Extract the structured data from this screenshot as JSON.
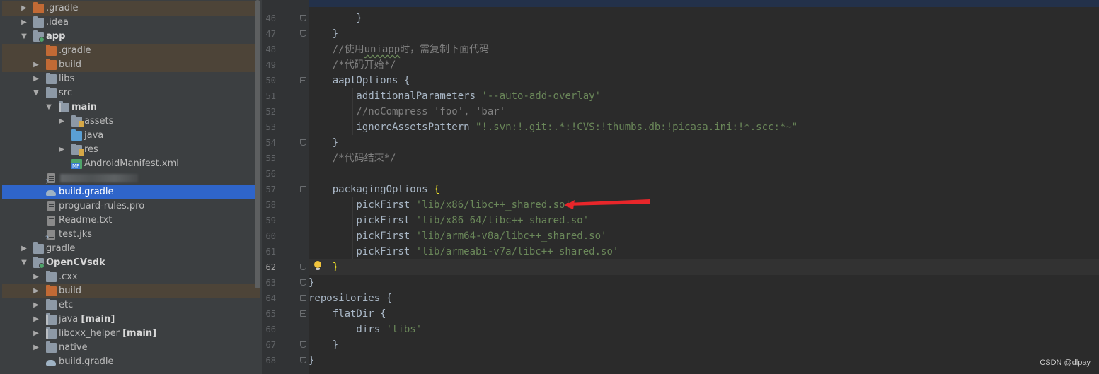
{
  "tree": {
    "items": [
      {
        "label": ".gradle",
        "bold": false
      },
      {
        "label": ".idea",
        "bold": false
      },
      {
        "label": "app",
        "bold": true
      },
      {
        "label": ".gradle",
        "bold": false
      },
      {
        "label": "build",
        "bold": false
      },
      {
        "label": "libs",
        "bold": false
      },
      {
        "label": "src",
        "bold": false
      },
      {
        "label": "main",
        "bold": true
      },
      {
        "label": "assets",
        "bold": false
      },
      {
        "label": "java",
        "bold": false
      },
      {
        "label": "res",
        "bold": false
      },
      {
        "label": "AndroidManifest.xml",
        "bold": false
      },
      {
        "label": "",
        "bold": false
      },
      {
        "label": "build.gradle",
        "bold": false
      },
      {
        "label": "proguard-rules.pro",
        "bold": false
      },
      {
        "label": "Readme.txt",
        "bold": false
      },
      {
        "label": "test.jks",
        "bold": false
      },
      {
        "label": "gradle",
        "bold": false
      },
      {
        "label": "OpenCVsdk",
        "bold": true
      },
      {
        "label": ".cxx",
        "bold": false
      },
      {
        "label": "build",
        "bold": false
      },
      {
        "label": "etc",
        "bold": false
      },
      {
        "label": "java",
        "bold": false,
        "suffix": "[main]"
      },
      {
        "label": "libcxx_helper",
        "bold": false,
        "suffix": "[main]"
      },
      {
        "label": "native",
        "bold": false
      },
      {
        "label": "build.gradle",
        "bold": false
      }
    ],
    "icons": {
      "folder": "folder-icon",
      "excluded_folder": "excluded-folder-icon",
      "module": "module-folder-icon",
      "gradle": "gradle-elephant-icon",
      "file": "text-file-icon",
      "manifest": "manifest-icon"
    }
  },
  "editor": {
    "lines": [
      {
        "n": "46",
        "text": "        }"
      },
      {
        "n": "47",
        "text": "    }"
      },
      {
        "n": "48",
        "text": "    //使用uniapp时，需复制下面代码"
      },
      {
        "n": "49",
        "text": "    /*代码开始*/"
      },
      {
        "n": "50",
        "text": "    aaptOptions {"
      },
      {
        "n": "51",
        "text_pre": "        additionalParameters ",
        "text_str": "'--auto-add-overlay'"
      },
      {
        "n": "52",
        "text": "        //noCompress 'foo', 'bar'"
      },
      {
        "n": "53",
        "text_pre": "        ignoreAssetsPattern ",
        "text_str": "\"!.svn:!.git:.*:!CVS:!thumbs.db:!picasa.ini:!*.scc:*~\""
      },
      {
        "n": "54",
        "text": "    }"
      },
      {
        "n": "55",
        "text": "    /*代码结束*/"
      },
      {
        "n": "56",
        "text": ""
      },
      {
        "n": "57",
        "text_pre": "    packagingOptions ",
        "text_brace": "{"
      },
      {
        "n": "58",
        "text_pre": "        pickFirst ",
        "text_str": "'lib/x86/libc++_shared.so'"
      },
      {
        "n": "59",
        "text_pre": "        pickFirst ",
        "text_str": "'lib/x86_64/libc++_shared.so'"
      },
      {
        "n": "60",
        "text_pre": "        pickFirst ",
        "text_str": "'lib/arm64-v8a/libc++_shared.so'"
      },
      {
        "n": "61",
        "text_pre": "        pickFirst ",
        "text_str": "'lib/armeabi-v7a/libc++_shared.so'"
      },
      {
        "n": "62",
        "text_pre": "    ",
        "text_brace": "}"
      },
      {
        "n": "63",
        "text": "}"
      },
      {
        "n": "64",
        "text": "repositories {"
      },
      {
        "n": "65",
        "text": "    flatDir {"
      },
      {
        "n": "66",
        "text_pre": "        dirs ",
        "text_str": "'libs'"
      },
      {
        "n": "67",
        "text": "    }"
      },
      {
        "n": "68",
        "text": "}"
      }
    ],
    "comment_48_prefix": "//使用",
    "comment_48_word": "uniapp",
    "comment_48_suffix": "时，需复制下面代码",
    "intention_icon": "lightbulb-icon",
    "annotation_arrow_color": "#e8262a",
    "colors": {
      "background": "#2b2b2b",
      "string": "#6a8759",
      "comment": "#808080",
      "text": "#a9b7c6",
      "brace_highlight": "#ffef28",
      "selection": "#2f65ca"
    }
  },
  "watermark": "CSDN @dlpay"
}
